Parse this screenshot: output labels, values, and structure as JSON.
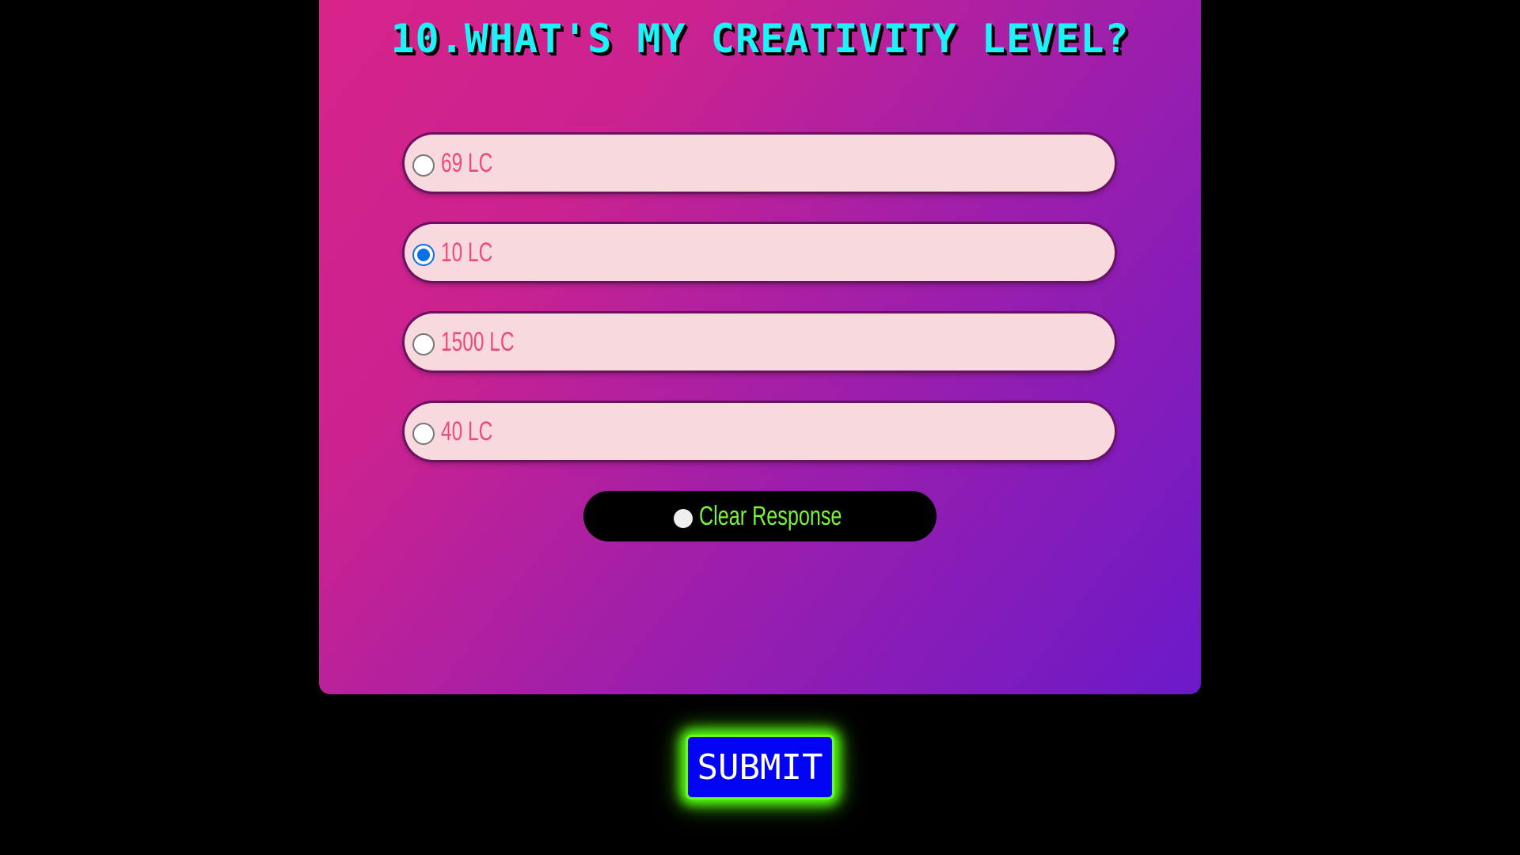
{
  "quiz": {
    "question": "10.WHAT'S MY CREATIVITY LEVEL?",
    "options": [
      {
        "label": "69 LC",
        "selected": false
      },
      {
        "label": "10 LC",
        "selected": true
      },
      {
        "label": "1500 LC",
        "selected": false
      },
      {
        "label": "40 LC",
        "selected": false
      }
    ],
    "clear_label": "Clear Response",
    "submit_label": "SUBMIT"
  },
  "colors": {
    "page_background": "#000000",
    "card_gradient_start": "#d8238a",
    "card_gradient_end": "#6b19c9",
    "question_text": "#1ef2f8",
    "option_background": "#f8dade",
    "option_text": "#ec4a7e",
    "radio_checked": "#0a6fe8",
    "clear_text": "#7cf23a",
    "submit_background": "#0202f4",
    "submit_glow": "#55ff11"
  }
}
